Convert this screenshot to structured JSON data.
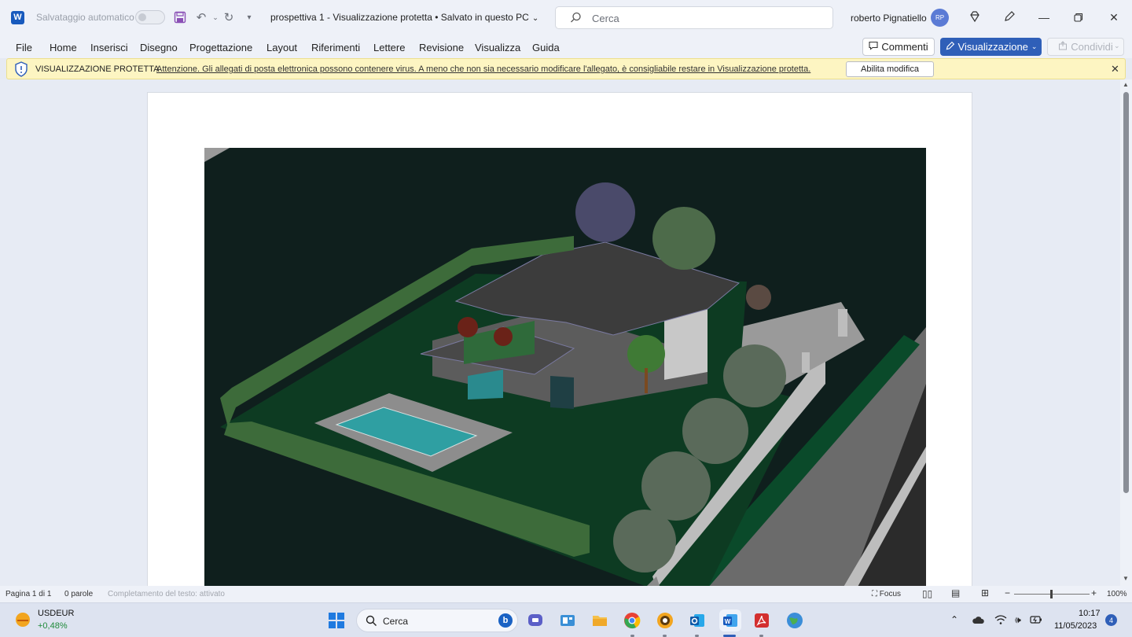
{
  "titlebar": {
    "app_logo": "W",
    "autosave_label": "Salvataggio automatico",
    "document_title": "prospettiva 1  -  Visualizzazione protetta • Salvato in questo PC",
    "search_placeholder": "Cerca",
    "user_name": "roberto Pignatiello",
    "user_initials": "RP"
  },
  "menu": {
    "items": [
      "File",
      "Home",
      "Inserisci",
      "Disegno",
      "Progettazione",
      "Layout",
      "Riferimenti",
      "Lettere",
      "Revisione",
      "Visualizza",
      "Guida"
    ],
    "comments_label": "Commenti",
    "view_label": "Visualizzazione",
    "share_label": "Condividi"
  },
  "protected_view": {
    "title": "VISUALIZZAZIONE PROTETTA",
    "message": "Attenzione. Gli allegati di posta elettronica possono contenere virus. A meno che non sia necessario modificare l'allegato, è consigliabile restare in Visualizzazione protetta.",
    "enable_button": "Abilita modifica"
  },
  "statusbar": {
    "page_info": "Pagina 1 di 1",
    "word_count": "0 parole",
    "text_prediction": "Completamento del testo: attivato",
    "focus_label": "Focus",
    "zoom_level": "100%"
  },
  "taskbar": {
    "widget_symbol": "USDEUR",
    "widget_change": "+0,48%",
    "search_label": "Cerca",
    "time": "10:17",
    "date": "11/05/2023",
    "notification_count": "4"
  },
  "colors": {
    "accent": "#2f5fb8",
    "word_blue": "#185abd",
    "protected_bar": "#fdf5c2",
    "render_background": "#0f1f1d",
    "lawn": "#0d3b22",
    "pool": "#2f9fa2",
    "positive_change": "#1f8a3a"
  }
}
